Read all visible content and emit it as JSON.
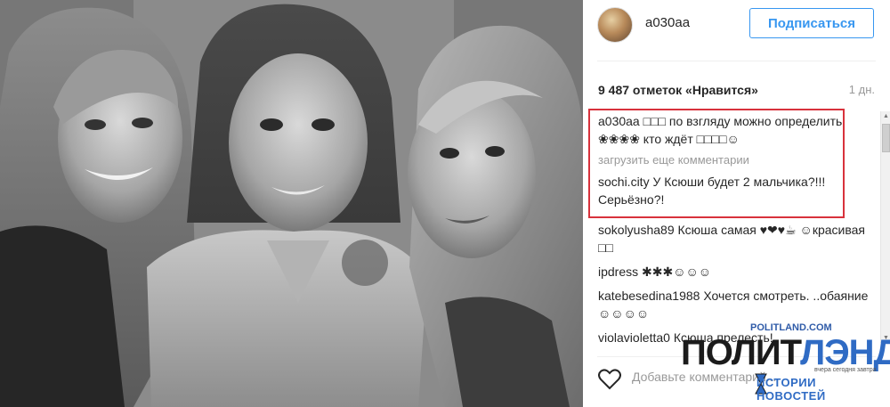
{
  "post": {
    "username": "a030aa",
    "follow_label": "Подписаться",
    "likes_text": "9 487 отметок «Нравится»",
    "time_ago": "1 дн.",
    "add_comment_placeholder": "Добавьте комментарий..."
  },
  "comments_highlighted": [
    {
      "user": "a030aa",
      "text": "□□□ по взгляду можно определить ❀❀❀❀ кто ждёт □□□□☺"
    },
    {
      "user": "sochi.city",
      "text": "У Ксюши будет 2 мальчика?!!! Серьёзно?!"
    }
  ],
  "load_more_label": "загрузить еще комментарии",
  "comments_other": [
    {
      "user": "sokolyusha89",
      "text": "Ксюша самая ♥❤♥☕ ☺красивая □□"
    },
    {
      "user": "ipdress",
      "text": "✱✱✱☺☺☺"
    },
    {
      "user": "katebesedina1988",
      "text": "Хочется смотреть. ..обаяние☺☺☺☺"
    },
    {
      "user": "violavioletta0",
      "text": "Ксюша прелесть!"
    }
  ],
  "watermark": {
    "url": "POLITLAND.COM",
    "brand_a": "ПОЛИТ",
    "brand_b": "ЛЭНД",
    "tagline": "ИСТОРИИ НОВОСТЕЙ",
    "tagline_small": "вчера сегодня завтра"
  },
  "icons": {
    "like": "heart-outline-icon",
    "scroll_up": "triangle-up-icon",
    "scroll_down": "triangle-down-icon",
    "watermark_glass": "hourglass-icon"
  },
  "colors": {
    "accent": "#3897f0",
    "highlight_border": "#d8323c",
    "watermark_blue": "#2f6bc4"
  }
}
